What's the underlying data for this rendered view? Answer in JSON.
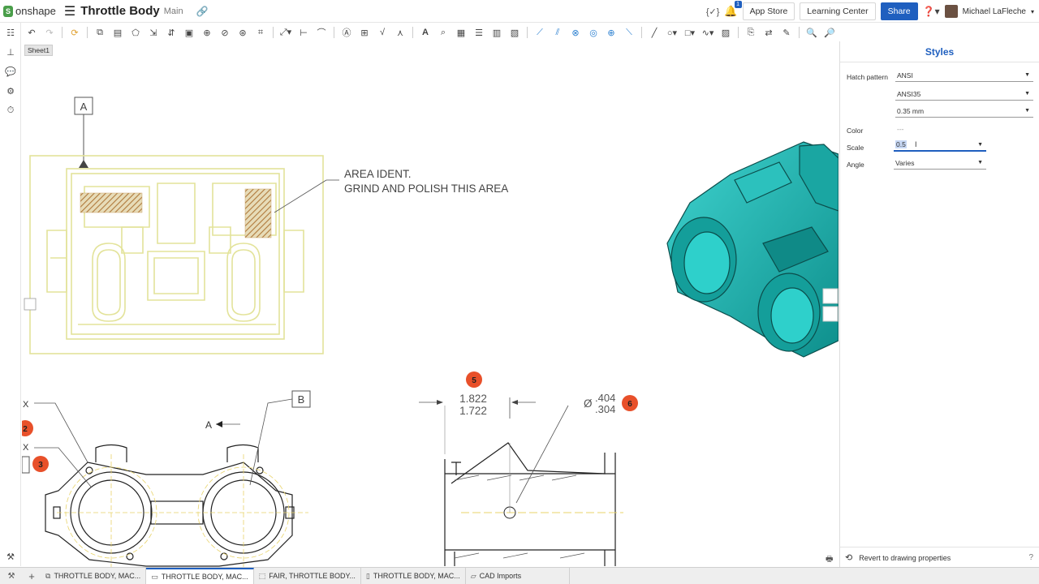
{
  "topbar": {
    "logo": "onshape",
    "title": "Throttle Body",
    "branch": "Main",
    "app_store": "App Store",
    "learning_center": "Learning Center",
    "share": "Share",
    "notifications": "1",
    "user": "Michael LaFleche"
  },
  "sheet": "Sheet1",
  "drawing": {
    "section_label": "A",
    "callout_b": "B",
    "note_line1": "AREA IDENT.",
    "note_line2": "GRIND AND POLISH THIS AREA",
    "balloon_2": "2",
    "balloon_3": "3",
    "balloon_5": "5",
    "balloon_6": "6",
    "dim_upper": "1.822",
    "dim_lower": "1.722",
    "dia_prefix": "Ø",
    "dia_upper": ".404",
    "dia_lower": ".304",
    "x_mark": "X",
    "arrow_a": "A"
  },
  "panel": {
    "title": "Styles",
    "hatch_label": "Hatch pattern",
    "hatch_value": "ANSI",
    "hatch_sub": "ANSI35",
    "hatch_width": "0.35 mm",
    "color_label": "Color",
    "color_value": "---",
    "scale_label": "Scale",
    "scale_value": "0.5",
    "angle_label": "Angle",
    "angle_value": "Varies",
    "revert": "Revert to drawing properties"
  },
  "tabs": [
    {
      "label": "THROTTLE BODY, MAC..."
    },
    {
      "label": "THROTTLE BODY, MAC..."
    },
    {
      "label": "FAIR, THROTTLE BODY..."
    },
    {
      "label": "THROTTLE BODY, MAC..."
    },
    {
      "label": "CAD Imports"
    }
  ],
  "colors": {
    "accent": "#1f5fbf",
    "highlight": "#e3e3a0",
    "hatch": "#b07a3c",
    "balloon": "#e8502a",
    "model": "#1bb3b0"
  }
}
